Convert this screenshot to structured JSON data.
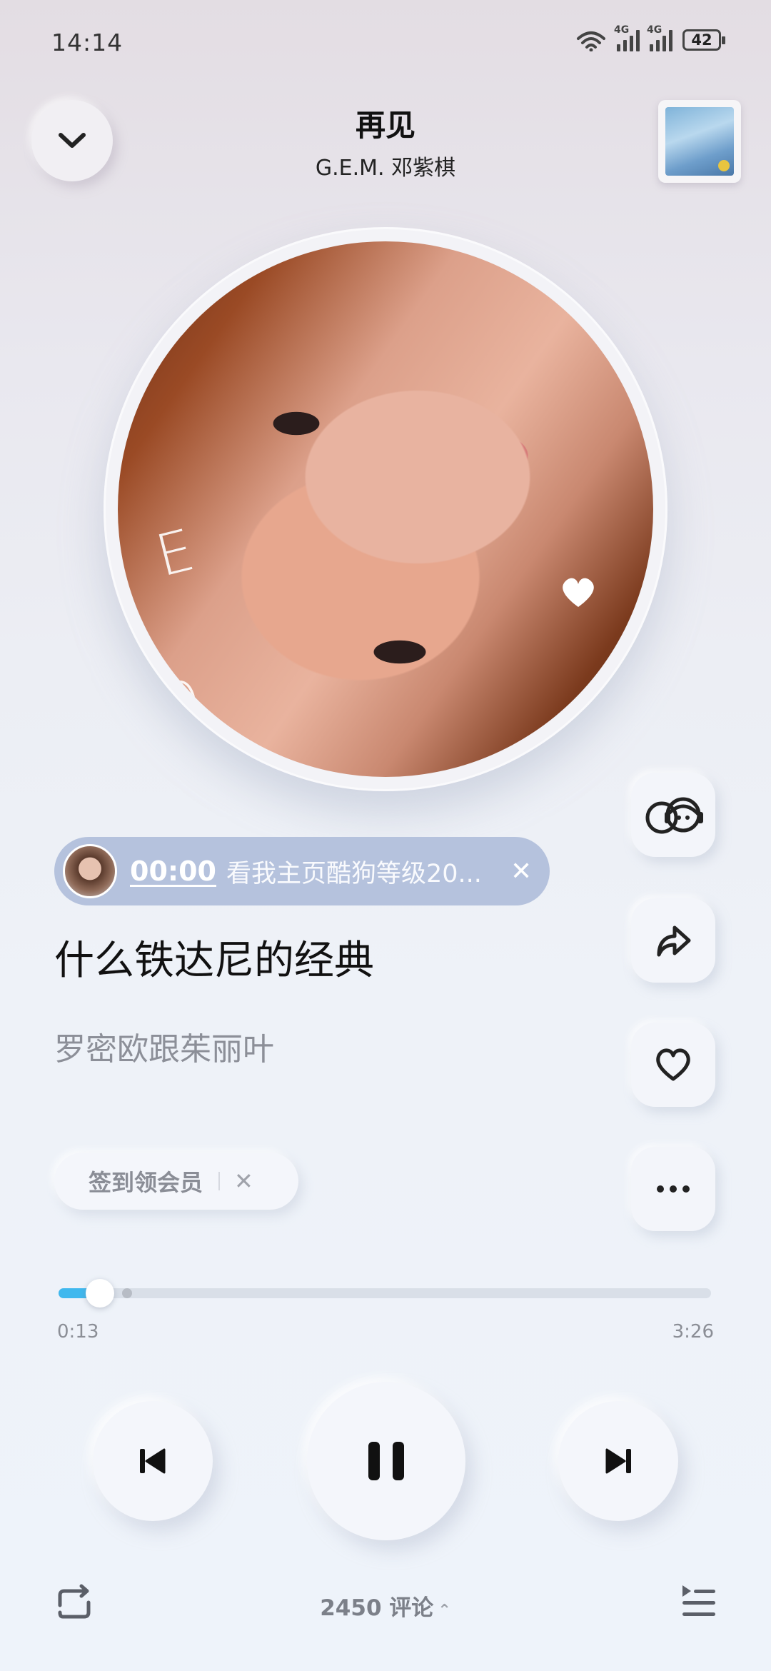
{
  "status_bar": {
    "time": "14:14",
    "network_1": "4G",
    "network_2": "4G",
    "battery": "42",
    "icons": [
      "wifi-icon",
      "signal-icon",
      "signal-icon",
      "battery-icon"
    ]
  },
  "header": {
    "title": "再见",
    "artist": "G.E.M. 邓紫棋",
    "collapse_icon": "chevron-down-icon",
    "thumbnail_icon": "mini-cover-thumbnail"
  },
  "side_actions": [
    {
      "name": "listen-together-icon"
    },
    {
      "name": "share-icon"
    },
    {
      "name": "heart-icon"
    },
    {
      "name": "more-icon"
    }
  ],
  "comment_chip": {
    "time": "00:00",
    "text": "看我主页酷狗等级20...",
    "close": "✕"
  },
  "lyrics": {
    "current": "什么铁达尼的经典",
    "next": "罗密欧跟茱丽叶"
  },
  "vip_pill": {
    "label": "签到领会员",
    "close": "✕"
  },
  "progress": {
    "current": "0:13",
    "duration": "3:26",
    "fraction": 0.063,
    "marker_fraction": 0.105
  },
  "controls": {
    "prev_icon": "previous-icon",
    "play_icon": "pause-icon",
    "next_icon": "next-icon"
  },
  "bottom_bar": {
    "repeat_icon": "repeat-icon",
    "comments": "2450 评论",
    "caret": "⌃",
    "playlist_icon": "playlist-icon"
  },
  "colors": {
    "accent": "#3fb8ee",
    "chip_bg": "#b5c2dd"
  }
}
